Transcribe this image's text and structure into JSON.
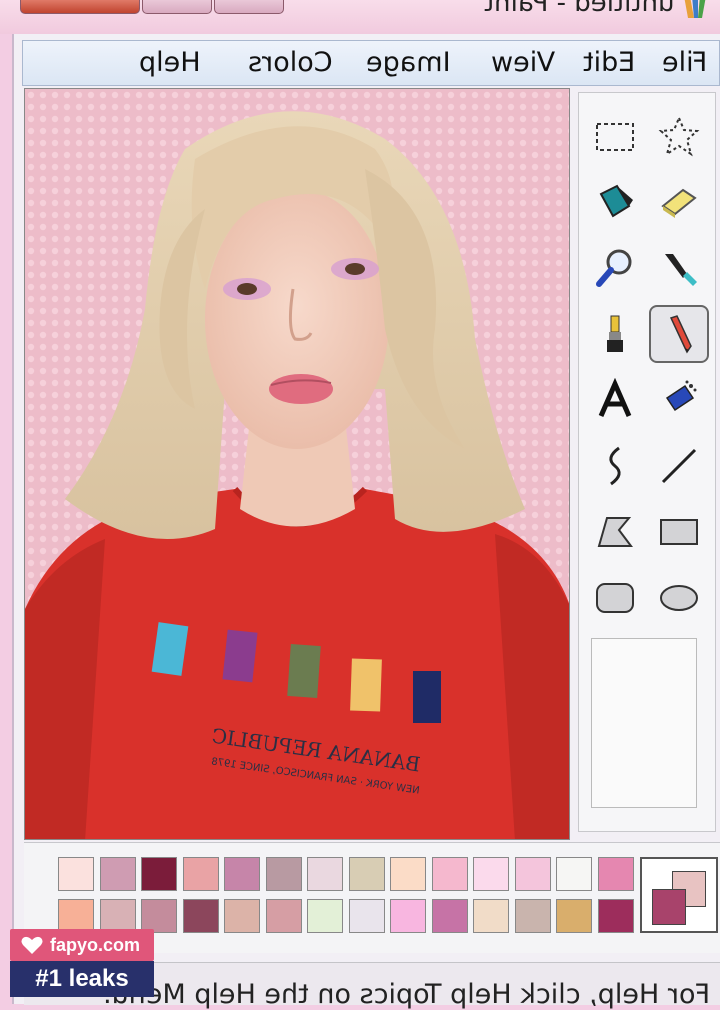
{
  "window": {
    "title": "untitled - Paint"
  },
  "menu": {
    "items": [
      "File",
      "Edit",
      "View",
      "Image",
      "Colors",
      "Help"
    ]
  },
  "tools": [
    {
      "name": "free-form-select",
      "icon": "star-select-icon"
    },
    {
      "name": "select",
      "icon": "rect-select-icon"
    },
    {
      "name": "eraser",
      "icon": "eraser-icon"
    },
    {
      "name": "fill",
      "icon": "paint-bucket-icon"
    },
    {
      "name": "pick-color",
      "icon": "eyedropper-icon"
    },
    {
      "name": "magnifier",
      "icon": "magnifier-icon"
    },
    {
      "name": "pencil",
      "icon": "pencil-icon",
      "selected": true
    },
    {
      "name": "brush",
      "icon": "brush-icon"
    },
    {
      "name": "airbrush",
      "icon": "airbrush-icon"
    },
    {
      "name": "text",
      "icon": "text-icon"
    },
    {
      "name": "line",
      "icon": "line-icon"
    },
    {
      "name": "curve",
      "icon": "curve-icon"
    },
    {
      "name": "rectangle",
      "icon": "rectangle-icon"
    },
    {
      "name": "polygon",
      "icon": "polygon-icon"
    },
    {
      "name": "ellipse",
      "icon": "ellipse-icon"
    },
    {
      "name": "rounded-rectangle",
      "icon": "rounded-rect-icon"
    }
  ],
  "palette": {
    "row1": [
      "#fbe1de",
      "#cf9cb2",
      "#7b1c3a",
      "#e9a3a5",
      "#c685a9",
      "#b89aa2",
      "#ead8e0",
      "#d8cdb4",
      "#fbdcc7",
      "#f5b8ce",
      "#fbdaec",
      "#f4c5dc",
      "#f6f6f4",
      "#e587b0"
    ],
    "row2": [
      "#f7b097",
      "#d8b1b5",
      "#c48c9c",
      "#8c465c",
      "#dcb3a8",
      "#d69ea4",
      "#e3f0d7",
      "#e9e4ec",
      "#f8b6e0",
      "#c673a6",
      "#f1dcc8",
      "#c9b4ad",
      "#d9ae6c",
      "#9d2d5c"
    ],
    "foreground": "#a8436b",
    "background": "#e8c3c2"
  },
  "status": {
    "text": "For Help, click Help Topics on the Help Menu."
  },
  "watermark": {
    "site": "fapyo.com",
    "tagline": "#1 leaks"
  },
  "canvas": {
    "shirt_print": [
      "BANANA REPUBLIC",
      "NEW YORK · SAN FRANCISCO, SINCE 1978"
    ]
  }
}
